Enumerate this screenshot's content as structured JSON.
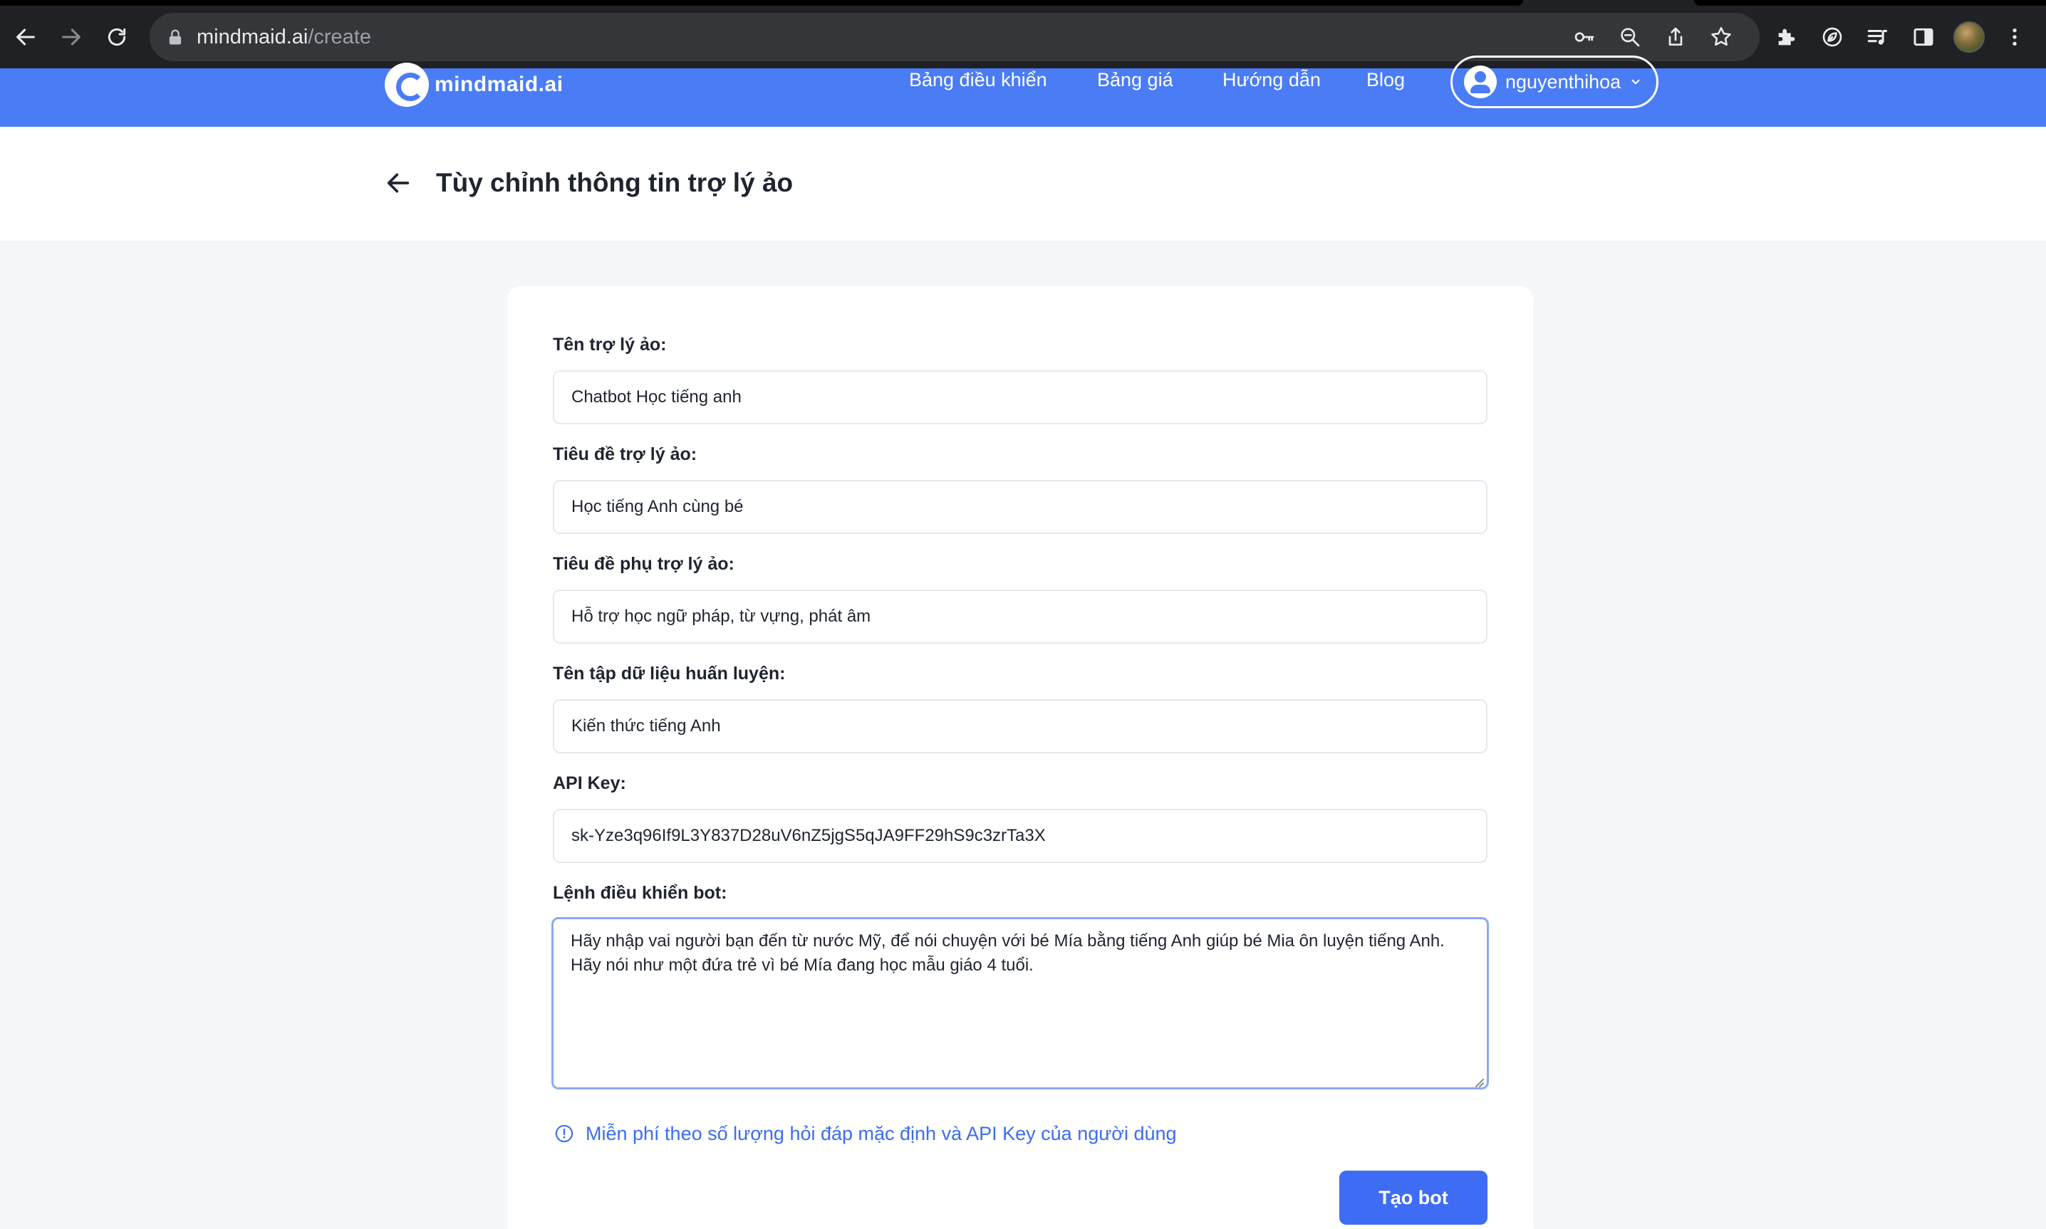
{
  "browser": {
    "url_domain": "mindmaid.ai",
    "url_path": "/create"
  },
  "site": {
    "logo_text": "mindmaid.ai",
    "brand_color": "#4a7cf6",
    "nav": [
      {
        "label": "Bảng điều khiển"
      },
      {
        "label": "Bảng giá"
      },
      {
        "label": "Hướng dẫn"
      },
      {
        "label": "Blog"
      }
    ],
    "username": "nguyenthihoa"
  },
  "page": {
    "title": "Tùy chỉnh thông tin trợ lý ảo"
  },
  "form": {
    "bot_name_label": "Tên trợ lý ảo:",
    "bot_name_value": "Chatbot Học tiếng anh",
    "title_label": "Tiêu đề trợ lý ảo:",
    "title_value": "Học tiếng Anh cùng bé",
    "subtitle_label": "Tiêu đề phụ trợ lý ảo:",
    "subtitle_value": "Hỗ trợ học ngữ pháp, từ vựng, phát âm",
    "dataset_label": "Tên tập dữ liệu huấn luyện:",
    "dataset_value": "Kiến thức tiếng Anh",
    "api_key_label": "API Key:",
    "api_key_value": "sk-Yze3q96If9L3Y837D28uV6nZ5jgS5qJA9FF29hS9c3zrTa3X",
    "prompt_label": "Lệnh điều khiển bot:",
    "prompt_value": "Hãy nhập vai người bạn đến từ nước Mỹ, để nói chuyện với bé Mía bằng tiếng Anh giúp bé Mia ôn luyện tiếng Anh. Hãy nói như một đứa trẻ vì bé Mía đang học mẫu giáo 4 tuổi.",
    "info_text": "Miễn phí theo số lượng hỏi đáp mặc định và API Key của người dùng",
    "submit_label": "Tạo bot",
    "accent_color": "#3f6cf4"
  }
}
